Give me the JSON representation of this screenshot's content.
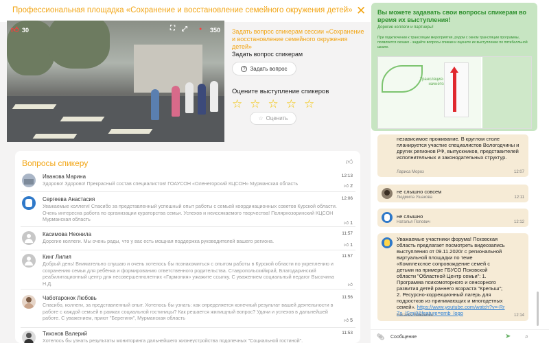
{
  "header": {
    "title": "Профессиональная площадка «Сохранение и восстановление семейного окружения детей»",
    "close": "✕"
  },
  "video": {
    "likes": "30",
    "viewers": "350"
  },
  "ask": {
    "session_link": "Задать вопрос спикерам сессии «Сохранение и восстановление семейного окружения детей»",
    "label": "Задать вопрос спикерам",
    "button": "Задать вопрос"
  },
  "rating": {
    "label": "Оцените выступление спикеров",
    "stars": 5,
    "button": "Оценить"
  },
  "questions": {
    "title": "Вопросы спикеру",
    "items": [
      {
        "name": "Иванова Марина",
        "text": "Здорово! Здорово! Прекрасный состав специалистов! ГОАУСОН «Оленегорский КЦСОН» Мурманская область",
        "time": "12:13",
        "count": "2"
      },
      {
        "name": "Сергеева Анастасия",
        "text": "Уважаемые коллеги! Спасибо за представленный успешный опыт работы с семьей координационных советов Курской области. Очень интересна работа по организации кураторства семьи. Успехов и неиссякаемого творчества! Полярнозоринский КЦСОН Мурманская область",
        "time": "12:06",
        "count": "1"
      },
      {
        "name": "Касимова Неонила",
        "text": "Дорогие коллеги. Мы очень рады, что у вас есть мощная поддержка руководителей вашего региона.",
        "time": "11:57",
        "count": "1"
      },
      {
        "name": "Кинг Лилия",
        "text": "Добрый день! Внимательно слушаю и очень хотелось бы познакомиться с опытом работы в Курской области по укреплению и сохранению семьи для ребёнка и формированию ответственного родительства. Ставропольскийкрай, Благодаринский реабилитационный центр для несовершеннолетних «Гармония» ужажите ссылку. С уважением социальный педагог Высочина Н.Д.",
        "time": "11:57",
        "count": ""
      },
      {
        "name": "Чаботаронок Любовь",
        "text": "Спасибо, коллеги, за представленный опыт. Хотелось бы узнать: как определяется конечный результат вашей деятельности в работе с каждой семьей в рамках социальной гостиницы? Как решается жилищный вопрос? Удачи и успехов в дальнейшей работе. С уважением, приют \"Берегиня\", Мурманская область",
        "time": "11:56",
        "count": "5"
      },
      {
        "name": "Тихонов Валерий",
        "text": "Хотелось бы узнать результаты мониторинга дальнейшего жизнеустройства подопечных \"Социальной гостиной\".",
        "time": "11:53",
        "count": ""
      }
    ]
  },
  "notice": {
    "title": "Вы можете задавать свои вопросы спикерам во время их выступления!",
    "subtitle": "Дорогие коллеги и партнеры!",
    "body": "При подключении к трансляции мероприятия, рядом с окном трансляции программы, появляется окошко - задайте вопросы спикам и оцените их выступление по пятибалльной шкале.",
    "preview_text": "Трансляция скоро начнется"
  },
  "chat": {
    "messages": [
      {
        "text": "независимое проживание. В круглом столе планируется участие специалистов Вологодчины и других регионов РФ, выпускников, представителей исполнительных и законодательных структур.",
        "author": "Лариса Мороз",
        "time": "12:07"
      },
      {
        "text": "не слышно совсем",
        "author": "Людмила Ушакова",
        "time": "12:11"
      },
      {
        "text": "не слышно",
        "author": "Наталья Попович",
        "time": "12:12"
      },
      {
        "text": "Уважаемые участники форума! Псковская область предлагает посмотреть видеозапись выступления от 09.11.2020г с региональной виртуальной площадки по теме «Комплексное сопровождение семей с детьми на примере ГБУСО Псковской области \"Областной Центр семьи\": 1. Программа психомоторного и сенсорного развития детей раннего возраста \"Крепыш\"; 2. Ресурсно-коррекционный лагерь для подростков из принимающих и многодетных семей».",
        "link": "https://www.youtube.com/watch?v=-RrZs_lSmi8&feature=emb_logo",
        "author": "Наталья Баженова",
        "time": "12:14"
      }
    ],
    "input_placeholder": "Сообщение"
  },
  "colors": {
    "accent": "#f2a514",
    "notice_bg": "#c7e5c2",
    "notice_text": "#2d8f2d",
    "chat_bubble": "#f6ebd6",
    "link": "#2a7fd6"
  }
}
